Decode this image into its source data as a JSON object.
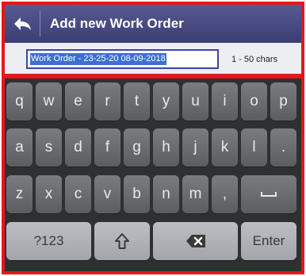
{
  "header": {
    "title": "Add new Work Order"
  },
  "input": {
    "value": "Work Order - 23-25-20 08-09-2018",
    "hint": "1 - 50 chars"
  },
  "keyboard": {
    "row1": [
      "q",
      "w",
      "e",
      "r",
      "t",
      "y",
      "u",
      "i",
      "o",
      "p"
    ],
    "row2": [
      "a",
      "s",
      "d",
      "f",
      "g",
      "h",
      "j",
      "k",
      "l",
      "."
    ],
    "row3": [
      "z",
      "x",
      "c",
      "v",
      "b",
      "n",
      "m",
      ","
    ],
    "mode_label": "?123",
    "enter_label": "Enter"
  },
  "colors": {
    "header": "#4a4d84",
    "keyboard_bg": "#2f3032",
    "annotation": "#e8151b"
  }
}
